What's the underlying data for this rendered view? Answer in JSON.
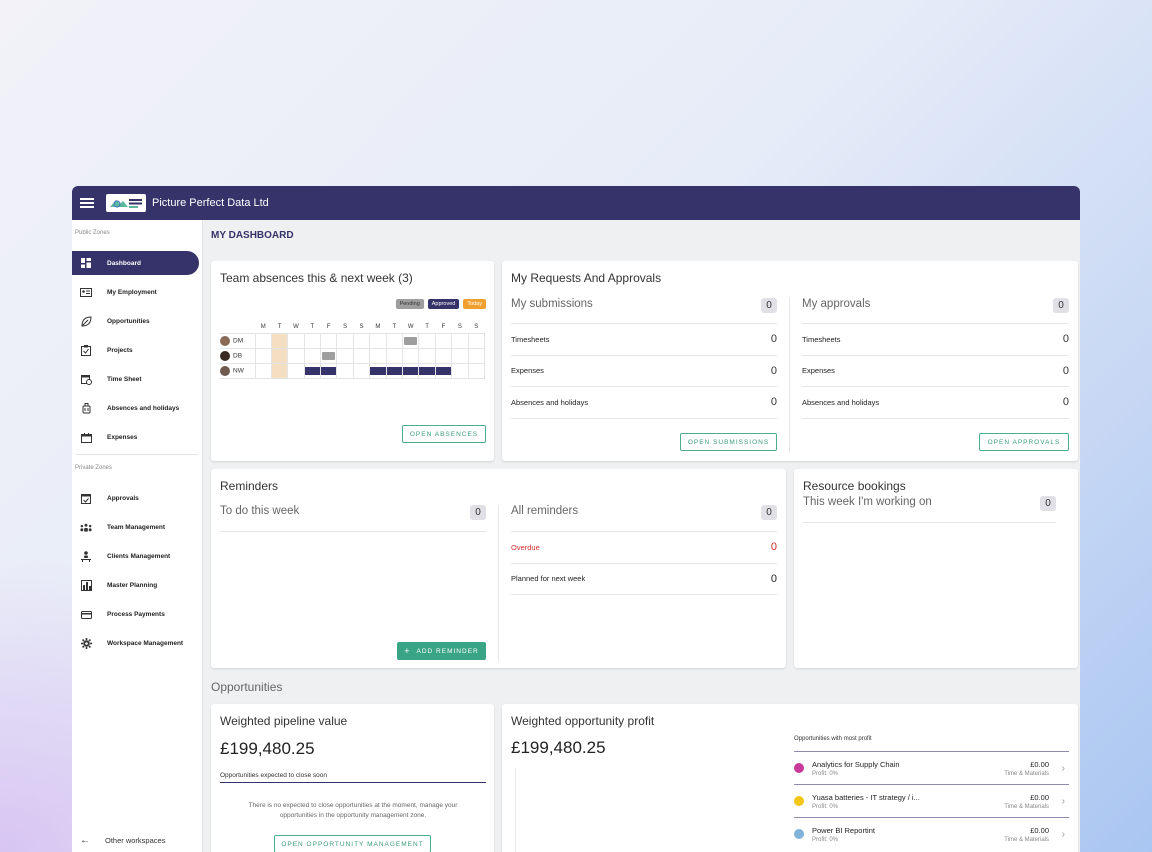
{
  "app": {
    "title": "Picture Perfect Data Ltd",
    "logo_text": "PICTURE PERFECT DATA"
  },
  "sidebar": {
    "public_label": "Public Zones",
    "private_label": "Private Zones",
    "public_items": [
      {
        "label": "Dashboard",
        "icon": "dashboard-icon",
        "active": true
      },
      {
        "label": "My Employment",
        "icon": "id-card-icon"
      },
      {
        "label": "Opportunities",
        "icon": "leaf-icon"
      },
      {
        "label": "Projects",
        "icon": "clipboard-icon"
      },
      {
        "label": "Time Sheet",
        "icon": "calendar-clock-icon"
      },
      {
        "label": "Absences and holidays",
        "icon": "luggage-icon"
      },
      {
        "label": "Expenses",
        "icon": "receipt-icon"
      }
    ],
    "private_items": [
      {
        "label": "Approvals",
        "icon": "calendar-check-icon"
      },
      {
        "label": "Team Management",
        "icon": "team-icon"
      },
      {
        "label": "Clients Management",
        "icon": "clients-icon"
      },
      {
        "label": "Master Planning",
        "icon": "planning-icon"
      },
      {
        "label": "Process Payments",
        "icon": "credit-card-icon"
      },
      {
        "label": "Workspace Management",
        "icon": "gear-icon"
      }
    ],
    "other_workspaces": "Other workspaces"
  },
  "page": {
    "title": "MY DASHBOARD"
  },
  "absences": {
    "title": "Team absences this & next week (3)",
    "legend": {
      "pending": "Pending",
      "approved": "Approved",
      "today": "Today"
    },
    "days": [
      "M",
      "T",
      "W",
      "T",
      "F",
      "S",
      "S",
      "M",
      "T",
      "W",
      "T",
      "F",
      "S",
      "S"
    ],
    "people": [
      {
        "initials": "DM",
        "avatar_color": "#8a6a55",
        "pending": [
          9
        ],
        "approved": []
      },
      {
        "initials": "DB",
        "avatar_color": "#3a2a22",
        "pending": [
          4
        ],
        "approved": []
      },
      {
        "initials": "NW",
        "avatar_color": "#6f5a4e",
        "pending": [],
        "approved": [
          3,
          4,
          7,
          8,
          9,
          10,
          11
        ]
      }
    ],
    "today_index": 1,
    "button": "OPEN ABSENCES"
  },
  "requests": {
    "title": "My Requests And Approvals",
    "submissions": {
      "heading": "My submissions",
      "count": "0",
      "rows": [
        {
          "label": "Timesheets",
          "value": "0"
        },
        {
          "label": "Expenses",
          "value": "0"
        },
        {
          "label": "Absences and holidays",
          "value": "0"
        }
      ],
      "button": "OPEN SUBMISSIONS"
    },
    "approvals": {
      "heading": "My approvals",
      "count": "0",
      "rows": [
        {
          "label": "Timesheets",
          "value": "0"
        },
        {
          "label": "Expenses",
          "value": "0"
        },
        {
          "label": "Absences and holidays",
          "value": "0"
        }
      ],
      "button": "OPEN APPROVALS"
    }
  },
  "reminders": {
    "title": "Reminders",
    "todo": {
      "heading": "To do this week",
      "count": "0"
    },
    "all": {
      "heading": "All reminders",
      "count": "0",
      "rows": [
        {
          "label": "Overdue",
          "value": "0",
          "color": "#d32f2f"
        },
        {
          "label": "Planned for next week",
          "value": "0",
          "color": "#222222"
        }
      ]
    },
    "button": "ADD REMINDER"
  },
  "bookings": {
    "title": "Resource bookings",
    "heading": "This week I'm working on",
    "count": "0"
  },
  "opportunities": {
    "section": "Opportunities",
    "pipeline": {
      "title": "Weighted pipeline value",
      "value": "£199,480.25",
      "subheading": "Opportunities expected to close soon",
      "empty_text": "There is no expected to close opportunities at the moment, manage your opportunities in the opportunity management zone.",
      "button": "OPEN OPPORTUNITY MANAGEMENT"
    },
    "profit": {
      "title": "Weighted opportunity profit",
      "value": "£199,480.25",
      "list_heading": "Opportunities with most profit",
      "items": [
        {
          "name": "Analytics for Supply Chain",
          "profit": "Profit: 0%",
          "amount": "£0.00",
          "type": "Time & Materials",
          "color": "#c8399a"
        },
        {
          "name": "Yuasa batteries - IT strategy / i...",
          "profit": "Profit: 0%",
          "amount": "£0.00",
          "type": "Time & Materials",
          "color": "#f5c518"
        },
        {
          "name": "Power BI Reportint",
          "profit": "Profit: 0%",
          "amount": "£0.00",
          "type": "Time & Materials",
          "color": "#7fb3d8"
        }
      ]
    }
  },
  "colors": {
    "primary": "#35336a",
    "accent": "#3aa586",
    "pending": "#9e9e9e",
    "today": "#f0a030"
  }
}
